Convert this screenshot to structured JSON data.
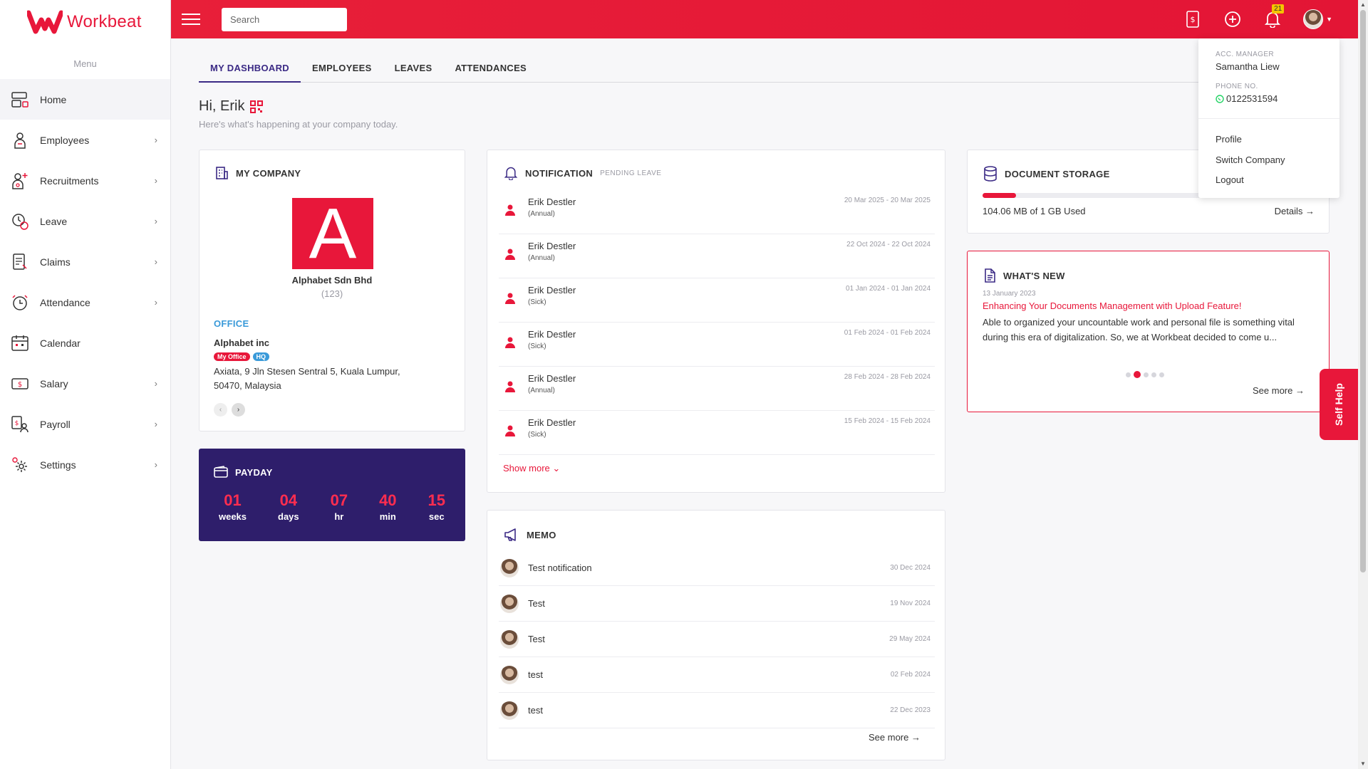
{
  "app": {
    "name": "Workbeat",
    "menu_label": "Menu"
  },
  "sidebar": {
    "items": [
      {
        "label": "Home",
        "icon": "home-icon",
        "has_chevron": false
      },
      {
        "label": "Employees",
        "icon": "employees-icon",
        "has_chevron": true
      },
      {
        "label": "Recruitments",
        "icon": "recruitments-icon",
        "has_chevron": true
      },
      {
        "label": "Leave",
        "icon": "leave-icon",
        "has_chevron": true
      },
      {
        "label": "Claims",
        "icon": "claims-icon",
        "has_chevron": true
      },
      {
        "label": "Attendance",
        "icon": "attendance-icon",
        "has_chevron": true
      },
      {
        "label": "Calendar",
        "icon": "calendar-icon",
        "has_chevron": false
      },
      {
        "label": "Salary",
        "icon": "salary-icon",
        "has_chevron": true
      },
      {
        "label": "Payroll",
        "icon": "payroll-icon",
        "has_chevron": true
      },
      {
        "label": "Settings",
        "icon": "settings-icon",
        "has_chevron": true
      }
    ]
  },
  "topbar": {
    "search_placeholder": "Search",
    "notification_count": "21"
  },
  "tabs": [
    {
      "label": "MY DASHBOARD",
      "active": true
    },
    {
      "label": "EMPLOYEES",
      "active": false
    },
    {
      "label": "LEAVES",
      "active": false
    },
    {
      "label": "ATTENDANCES",
      "active": false
    }
  ],
  "greeting": {
    "title": "Hi, Erik",
    "subtitle": "Here's what's happening at your company today."
  },
  "company": {
    "header": "MY COMPANY",
    "logo_letter": "A",
    "name": "Alphabet Sdn Bhd",
    "code": "(123)",
    "office_label": "OFFICE",
    "office_name": "Alphabet inc",
    "tag_my_office": "My Office",
    "tag_hq": "HQ",
    "address_line1": "Axiata, 9 Jln Stesen Sentral 5, Kuala Lumpur,",
    "address_line2": "50470, Malaysia"
  },
  "payday": {
    "header": "PAYDAY",
    "units": [
      {
        "value": "01",
        "label": "weeks"
      },
      {
        "value": "04",
        "label": "days"
      },
      {
        "value": "07",
        "label": "hr"
      },
      {
        "value": "40",
        "label": "min"
      },
      {
        "value": "15",
        "label": "sec"
      }
    ]
  },
  "notification": {
    "header": "NOTIFICATION",
    "sub": "PENDING LEAVE",
    "items": [
      {
        "name": "Erik Destler",
        "type": "(Annual)",
        "date": "20 Mar 2025 - 20 Mar 2025"
      },
      {
        "name": "Erik Destler",
        "type": "(Annual)",
        "date": "22 Oct 2024 - 22 Oct 2024"
      },
      {
        "name": "Erik Destler",
        "type": "(Sick)",
        "date": "01 Jan 2024 - 01 Jan 2024"
      },
      {
        "name": "Erik Destler",
        "type": "(Sick)",
        "date": "01 Feb 2024 - 01 Feb 2024"
      },
      {
        "name": "Erik Destler",
        "type": "(Annual)",
        "date": "28 Feb 2024 - 28 Feb 2024"
      },
      {
        "name": "Erik Destler",
        "type": "(Sick)",
        "date": "15 Feb 2024 - 15 Feb 2024"
      }
    ],
    "show_more": "Show more"
  },
  "memo": {
    "header": "MEMO",
    "items": [
      {
        "title": "Test notification",
        "date": "30 Dec 2024"
      },
      {
        "title": "Test",
        "date": "19 Nov 2024"
      },
      {
        "title": "Test",
        "date": "29 May 2024"
      },
      {
        "title": "test",
        "date": "02 Feb 2024"
      },
      {
        "title": "test",
        "date": "22 Dec 2023"
      }
    ],
    "see_more": "See more"
  },
  "storage": {
    "header": "DOCUMENT STORAGE",
    "used_text": "104.06 MB of 1 GB Used",
    "used_fraction": 0.1,
    "details": "Details"
  },
  "whats_new": {
    "header": "WHAT'S NEW",
    "date": "13 January 2023",
    "headline": "Enhancing Your Documents Management with Upload Feature!",
    "body": "Able to organized your uncountable work and personal file is something vital during this era of digitalization.  So, we at Workbeat decided to come u...",
    "see_more": "See more",
    "slides": 5,
    "active_slide": 1
  },
  "account_menu": {
    "manager_label": "ACC. MANAGER",
    "manager_name": "Samantha Liew",
    "phone_label": "PHONE NO.",
    "phone": "0122531594",
    "links": [
      "Profile",
      "Switch Company",
      "Logout"
    ]
  },
  "self_help": "Self Help",
  "colors": {
    "brand_red": "#e8173a",
    "payday_bg": "#2e1e6b",
    "tab_active": "#3b2a85",
    "office_blue": "#3a9ad9"
  }
}
